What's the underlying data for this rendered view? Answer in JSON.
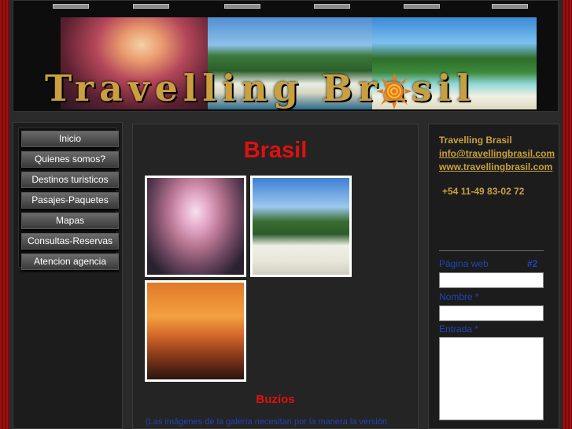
{
  "header": {
    "title": "Travelling Brasil"
  },
  "nav": {
    "items": [
      {
        "label": "Inicio"
      },
      {
        "label": "Quienes somos?"
      },
      {
        "label": "Destinos turisticos"
      },
      {
        "label": "Pasajes-Paquetes"
      },
      {
        "label": "Mapas"
      },
      {
        "label": "Consultas-Reservas"
      },
      {
        "label": "Atencion agencia"
      }
    ]
  },
  "main": {
    "title": "Brasil",
    "subheading": "Buzíos",
    "note": "(Las imágenes de la galería necesitan por la manera la versión"
  },
  "sidebar": {
    "company": "Travelling Brasil",
    "email": "info@travellingbrasil.com",
    "website": "www.travellingbrasil.com",
    "phone": "+54 11-49 83-02 72",
    "form": {
      "field1_label": "Página web",
      "field1_marker": "#2",
      "field2_label": "Nombre *",
      "field3_label": "Entrada *"
    }
  },
  "colors": {
    "accent_red": "#e01010",
    "gold": "#c8a040",
    "link_blue": "#1e46b4",
    "background_red": "#8a0c0c"
  }
}
